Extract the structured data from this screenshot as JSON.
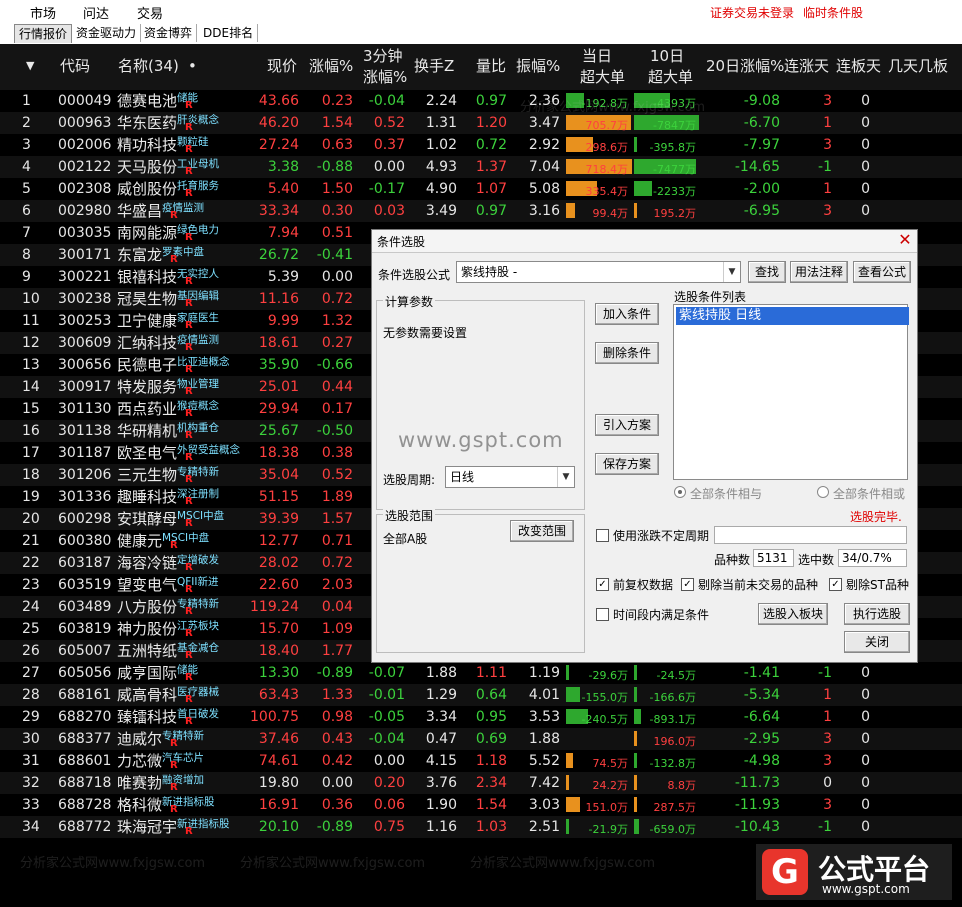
{
  "menu": {
    "items": [
      "市场",
      "问达",
      "交易"
    ],
    "alert_login": "证券交易未登录",
    "alert_cond": "临时条件股"
  },
  "tabs": [
    "行情报价",
    "资金驱动力",
    "资金博弈",
    "DDE排名"
  ],
  "header": {
    "sort_icon": "triangle-down-icon",
    "code": "代码",
    "name": "名称(34)",
    "name_dot": "•",
    "price": "现价",
    "chg": "涨幅%",
    "chg3_l1": "3分钟",
    "chg3_l2": "涨幅%",
    "turnover": "换手Z",
    "volratio": "量比",
    "amplitude": "振幅%",
    "today_l1": "当日",
    "today_l2": "超大单",
    "d10_l1": "10日",
    "d10_l2": "超大单",
    "d20": "20日涨幅%",
    "updays": "连涨天",
    "limitdays": "连板天",
    "jitian": "几天几板"
  },
  "rows": [
    {
      "no": "1",
      "code": "000049",
      "name": "德赛电池",
      "concept": "储能",
      "price": "43.66",
      "chg": "0.23",
      "chg3": "-0.04",
      "turn": "2.24",
      "vr": "0.97",
      "amp": "2.36",
      "today": "-192.8万",
      "today_v": -192.8,
      "d10": "-4393万",
      "d10_v": -4393,
      "d20": "-9.08",
      "up": "3",
      "lim": "0"
    },
    {
      "no": "2",
      "code": "000963",
      "name": "华东医药",
      "concept": "肝炎概念",
      "price": "46.20",
      "chg": "1.54",
      "chg3": "0.52",
      "turn": "1.31",
      "vr": "1.20",
      "amp": "3.47",
      "today": "705.7万",
      "today_v": 705.7,
      "d10": "-7847万",
      "d10_v": -7847,
      "d20": "-6.70",
      "up": "1",
      "lim": "0"
    },
    {
      "no": "3",
      "code": "002006",
      "name": "精功科技",
      "concept": "颗粒硅",
      "price": "27.24",
      "chg": "0.63",
      "chg3": "0.37",
      "turn": "1.02",
      "vr": "0.72",
      "amp": "2.92",
      "today": "298.6万",
      "today_v": 298.6,
      "d10": "-395.8万",
      "d10_v": -395.8,
      "d20": "-7.97",
      "up": "3",
      "lim": "0"
    },
    {
      "no": "4",
      "code": "002122",
      "name": "天马股份",
      "concept": "工业母机",
      "price": "3.38",
      "chg": "-0.88",
      "chg3": "0.00",
      "turn": "4.93",
      "vr": "1.37",
      "amp": "7.04",
      "today": "718.4万",
      "today_v": 718.4,
      "d10": "-7477万",
      "d10_v": -7477,
      "d20": "-14.65",
      "up": "-1",
      "lim": "0"
    },
    {
      "no": "5",
      "code": "002308",
      "name": "威创股份",
      "concept": "托育服务",
      "price": "5.40",
      "chg": "1.50",
      "chg3": "-0.17",
      "turn": "4.90",
      "vr": "1.07",
      "amp": "5.08",
      "today": "335.4万",
      "today_v": 335.4,
      "d10": "-2233万",
      "d10_v": -2233,
      "d20": "-2.00",
      "up": "1",
      "lim": "0"
    },
    {
      "no": "6",
      "code": "002980",
      "name": "华盛昌",
      "concept": "疫情监测",
      "price": "33.34",
      "chg": "0.30",
      "chg3": "0.03",
      "turn": "3.49",
      "vr": "0.97",
      "amp": "3.16",
      "today": "99.4万",
      "today_v": 99.4,
      "d10": "195.2万",
      "d10_v": 195.2,
      "d20": "-6.95",
      "up": "3",
      "lim": "0"
    },
    {
      "no": "7",
      "code": "003035",
      "name": "南网能源",
      "concept": "绿色电力",
      "price": "7.94",
      "chg": "0.51",
      "chg3": "",
      "turn": "",
      "vr": "",
      "amp": "",
      "today": "",
      "today_v": 0,
      "d10": "",
      "d10_v": 0,
      "d20": "",
      "up": "",
      "lim": ""
    },
    {
      "no": "8",
      "code": "300171",
      "name": "东富龙",
      "concept": "罗素中盘",
      "price": "26.72",
      "chg": "-0.41",
      "chg3": "",
      "turn": "",
      "vr": "",
      "amp": "",
      "today": "",
      "today_v": 0,
      "d10": "",
      "d10_v": 0,
      "d20": "",
      "up": "",
      "lim": ""
    },
    {
      "no": "9",
      "code": "300221",
      "name": "银禧科技",
      "concept": "无实控人",
      "price": "5.39",
      "chg": "0.00",
      "chg3": "",
      "turn": "",
      "vr": "",
      "amp": "",
      "today": "",
      "today_v": 0,
      "d10": "",
      "d10_v": 0,
      "d20": "",
      "up": "",
      "lim": ""
    },
    {
      "no": "10",
      "code": "300238",
      "name": "冠昊生物",
      "concept": "基因编辑",
      "price": "11.16",
      "chg": "0.72",
      "chg3": "",
      "turn": "",
      "vr": "",
      "amp": "",
      "today": "",
      "today_v": 0,
      "d10": "",
      "d10_v": 0,
      "d20": "",
      "up": "",
      "lim": ""
    },
    {
      "no": "11",
      "code": "300253",
      "name": "卫宁健康",
      "concept": "家庭医生",
      "price": "9.99",
      "chg": "1.32",
      "chg3": "",
      "turn": "",
      "vr": "",
      "amp": "",
      "today": "",
      "today_v": 0,
      "d10": "",
      "d10_v": 0,
      "d20": "",
      "up": "",
      "lim": ""
    },
    {
      "no": "12",
      "code": "300609",
      "name": "汇纳科技",
      "concept": "疫情监测",
      "price": "18.61",
      "chg": "0.27",
      "chg3": "",
      "turn": "",
      "vr": "",
      "amp": "",
      "today": "",
      "today_v": 0,
      "d10": "",
      "d10_v": 0,
      "d20": "",
      "up": "",
      "lim": ""
    },
    {
      "no": "13",
      "code": "300656",
      "name": "民德电子",
      "concept": "比亚迪概念",
      "price": "35.90",
      "chg": "-0.66",
      "chg3": "",
      "turn": "",
      "vr": "",
      "amp": "",
      "today": "",
      "today_v": 0,
      "d10": "",
      "d10_v": 0,
      "d20": "",
      "up": "",
      "lim": ""
    },
    {
      "no": "14",
      "code": "300917",
      "name": "特发服务",
      "concept": "物业管理",
      "price": "25.01",
      "chg": "0.44",
      "chg3": "",
      "turn": "",
      "vr": "",
      "amp": "",
      "today": "",
      "today_v": 0,
      "d10": "",
      "d10_v": 0,
      "d20": "",
      "up": "",
      "lim": ""
    },
    {
      "no": "15",
      "code": "301130",
      "name": "西点药业",
      "concept": "猴痘概念",
      "price": "29.94",
      "chg": "0.17",
      "chg3": "",
      "turn": "",
      "vr": "",
      "amp": "",
      "today": "",
      "today_v": 0,
      "d10": "",
      "d10_v": 0,
      "d20": "",
      "up": "",
      "lim": ""
    },
    {
      "no": "16",
      "code": "301138",
      "name": "华研精机",
      "concept": "机构重仓",
      "price": "25.67",
      "chg": "-0.50",
      "chg3": "",
      "turn": "",
      "vr": "",
      "amp": "",
      "today": "",
      "today_v": 0,
      "d10": "",
      "d10_v": 0,
      "d20": "",
      "up": "",
      "lim": ""
    },
    {
      "no": "17",
      "code": "301187",
      "name": "欧圣电气",
      "concept": "外贸受益概念",
      "price": "18.38",
      "chg": "0.38",
      "chg3": "",
      "turn": "",
      "vr": "",
      "amp": "",
      "today": "",
      "today_v": 0,
      "d10": "",
      "d10_v": 0,
      "d20": "",
      "up": "",
      "lim": ""
    },
    {
      "no": "18",
      "code": "301206",
      "name": "三元生物",
      "concept": "专精特新",
      "price": "35.04",
      "chg": "0.52",
      "chg3": "",
      "turn": "",
      "vr": "",
      "amp": "",
      "today": "",
      "today_v": 0,
      "d10": "",
      "d10_v": 0,
      "d20": "",
      "up": "",
      "lim": ""
    },
    {
      "no": "19",
      "code": "301336",
      "name": "趣睡科技",
      "concept": "深注册制",
      "price": "51.15",
      "chg": "1.89",
      "chg3": "",
      "turn": "",
      "vr": "",
      "amp": "",
      "today": "",
      "today_v": 0,
      "d10": "",
      "d10_v": 0,
      "d20": "",
      "up": "",
      "lim": ""
    },
    {
      "no": "20",
      "code": "600298",
      "name": "安琪酵母",
      "concept": "MSCI中盘",
      "price": "39.39",
      "chg": "1.57",
      "chg3": "",
      "turn": "",
      "vr": "",
      "amp": "",
      "today": "",
      "today_v": 0,
      "d10": "",
      "d10_v": 0,
      "d20": "",
      "up": "",
      "lim": ""
    },
    {
      "no": "21",
      "code": "600380",
      "name": "健康元",
      "concept": "MSCI中盘",
      "price": "12.77",
      "chg": "0.71",
      "chg3": "",
      "turn": "",
      "vr": "",
      "amp": "",
      "today": "",
      "today_v": 0,
      "d10": "",
      "d10_v": 0,
      "d20": "",
      "up": "",
      "lim": ""
    },
    {
      "no": "22",
      "code": "603187",
      "name": "海容冷链",
      "concept": "定增破发",
      "price": "28.02",
      "chg": "0.72",
      "chg3": "",
      "turn": "",
      "vr": "",
      "amp": "",
      "today": "",
      "today_v": 0,
      "d10": "",
      "d10_v": 0,
      "d20": "",
      "up": "",
      "lim": ""
    },
    {
      "no": "23",
      "code": "603519",
      "name": "望变电气",
      "concept": "QFII新进",
      "price": "22.60",
      "chg": "2.03",
      "chg3": "",
      "turn": "",
      "vr": "",
      "amp": "",
      "today": "",
      "today_v": 0,
      "d10": "",
      "d10_v": 0,
      "d20": "",
      "up": "",
      "lim": ""
    },
    {
      "no": "24",
      "code": "603489",
      "name": "八方股份",
      "concept": "专精特新",
      "price": "119.24",
      "chg": "0.04",
      "chg3": "",
      "turn": "",
      "vr": "",
      "amp": "",
      "today": "",
      "today_v": 0,
      "d10": "",
      "d10_v": 0,
      "d20": "",
      "up": "",
      "lim": ""
    },
    {
      "no": "25",
      "code": "603819",
      "name": "神力股份",
      "concept": "江苏板块",
      "price": "15.70",
      "chg": "1.09",
      "chg3": "",
      "turn": "",
      "vr": "",
      "amp": "",
      "today": "",
      "today_v": 0,
      "d10": "",
      "d10_v": 0,
      "d20": "",
      "up": "",
      "lim": ""
    },
    {
      "no": "26",
      "code": "605007",
      "name": "五洲特纸",
      "concept": "基金减仓",
      "price": "18.40",
      "chg": "1.77",
      "chg3": "",
      "turn": "",
      "vr": "",
      "amp": "",
      "today": "",
      "today_v": 0,
      "d10": "",
      "d10_v": 0,
      "d20": "",
      "up": "",
      "lim": ""
    },
    {
      "no": "27",
      "code": "605056",
      "name": "咸亨国际",
      "concept": "储能",
      "price": "13.30",
      "chg": "-0.89",
      "chg3": "-0.07",
      "turn": "1.88",
      "vr": "1.11",
      "amp": "1.19",
      "today": "-29.6万",
      "today_v": -29.6,
      "d10": "-24.5万",
      "d10_v": -24.5,
      "d20": "-1.41",
      "up": "-1",
      "lim": "0"
    },
    {
      "no": "28",
      "code": "688161",
      "name": "威高骨科",
      "concept": "医疗器械",
      "price": "63.43",
      "chg": "1.33",
      "chg3": "-0.01",
      "turn": "1.29",
      "vr": "0.64",
      "amp": "4.01",
      "today": "-155.0万",
      "today_v": -155.0,
      "d10": "-166.6万",
      "d10_v": -166.6,
      "d20": "-5.34",
      "up": "1",
      "lim": "0"
    },
    {
      "no": "29",
      "code": "688270",
      "name": "臻镭科技",
      "concept": "首日破发",
      "price": "100.75",
      "chg": "0.98",
      "chg3": "-0.05",
      "turn": "3.34",
      "vr": "0.95",
      "amp": "3.53",
      "today": "-240.5万",
      "today_v": -240.5,
      "d10": "-893.1万",
      "d10_v": -893.1,
      "d20": "-6.64",
      "up": "1",
      "lim": "0"
    },
    {
      "no": "30",
      "code": "688377",
      "name": "迪威尔",
      "concept": "专精特新",
      "price": "37.46",
      "chg": "0.43",
      "chg3": "-0.04",
      "turn": "0.47",
      "vr": "0.69",
      "amp": "1.88",
      "today": "",
      "today_v": 0,
      "d10": "196.0万",
      "d10_v": 196.0,
      "d20": "-2.95",
      "up": "3",
      "lim": "0"
    },
    {
      "no": "31",
      "code": "688601",
      "name": "力芯微",
      "concept": "汽车芯片",
      "price": "74.61",
      "chg": "0.42",
      "chg3": "0.00",
      "turn": "4.15",
      "vr": "1.18",
      "amp": "5.52",
      "today": "74.5万",
      "today_v": 74.5,
      "d10": "-132.8万",
      "d10_v": -132.8,
      "d20": "-4.98",
      "up": "3",
      "lim": "0"
    },
    {
      "no": "32",
      "code": "688718",
      "name": "唯赛勃",
      "concept": "融资增加",
      "price": "19.80",
      "chg": "0.00",
      "chg3": "0.20",
      "turn": "3.76",
      "vr": "2.34",
      "amp": "7.42",
      "today": "24.2万",
      "today_v": 24.2,
      "d10": "8.8万",
      "d10_v": 8.8,
      "d20": "-11.73",
      "up": "0",
      "lim": "0"
    },
    {
      "no": "33",
      "code": "688728",
      "name": "格科微",
      "concept": "新进指标股",
      "price": "16.91",
      "chg": "0.36",
      "chg3": "0.06",
      "turn": "1.90",
      "vr": "1.54",
      "amp": "3.03",
      "today": "151.0万",
      "today_v": 151.0,
      "d10": "287.5万",
      "d10_v": 287.5,
      "d20": "-11.93",
      "up": "3",
      "lim": "0"
    },
    {
      "no": "34",
      "code": "688772",
      "name": "珠海冠宇",
      "concept": "新进指标股",
      "price": "20.10",
      "chg": "-0.89",
      "chg3": "0.75",
      "turn": "1.16",
      "vr": "1.03",
      "amp": "2.51",
      "today": "-21.9万",
      "today_v": -21.9,
      "d10": "-659.0万",
      "d10_v": -659.0,
      "d20": "-10.43",
      "up": "-1",
      "lim": "0"
    }
  ],
  "row_marker": "R",
  "colors": {
    "up": "#ff4040",
    "down": "#3cd23c",
    "flat": "#e6e6e6",
    "bar_pos": "#e8911e",
    "bar_neg": "#2ea82e"
  },
  "dialog": {
    "title": "条件选股",
    "close_icon": "close-icon",
    "formula_label": "条件选股公式",
    "formula_value": "紫线持股     -",
    "btn_find": "查找",
    "btn_usage": "用法注释",
    "btn_view": "查看公式",
    "params_title": "计算参数",
    "params_text": "无参数需要设置",
    "btn_add": "加入条件",
    "btn_delete": "删除条件",
    "btn_import": "引入方案",
    "btn_save": "保存方案",
    "list_title": "选股条件列表",
    "list_items": [
      "紫线持股  日线"
    ],
    "period_label": "选股周期:",
    "period_value": "日线",
    "watermark": "www.gspt.com",
    "radio_and": "全部条件相与",
    "radio_or": "全部条件相或",
    "status": "选股完毕.",
    "range_title": "选股范围",
    "range_value": "全部A股",
    "btn_range": "改变范围",
    "chk_unsettled": "使用涨跌不定周期",
    "count_label": "品种数",
    "count_value": "5131",
    "selected_label": "选中数",
    "selected_value": "34/0.7%",
    "chk_rights": "前复权数据",
    "chk_exclude_untraded": "剔除当前未交易的品种",
    "chk_exclude_st": "剔除ST品种",
    "chk_time_range": "时间段内满足条件",
    "btn_to_block": "选股入板块",
    "btn_execute": "执行选股",
    "btn_close": "关闭"
  },
  "watermark_text": "分析家公式网www.fxjgsw.com",
  "logo": {
    "brand": "公式平台",
    "url": "www.gspt.com",
    "mark": "G"
  }
}
